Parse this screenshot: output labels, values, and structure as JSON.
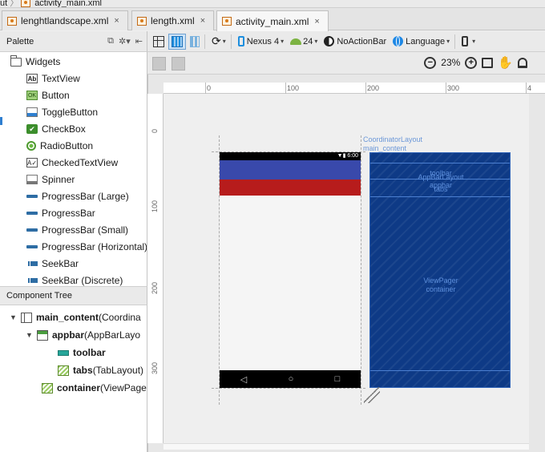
{
  "breadcrumb": {
    "first": "ut",
    "file": "activity_main.xml"
  },
  "tabs": [
    {
      "label": "lenghtlandscape.xml",
      "close": "×"
    },
    {
      "label": "length.xml",
      "close": "×"
    },
    {
      "label": "activity_main.xml",
      "close": "×",
      "active": true
    }
  ],
  "palette": {
    "title": "Palette",
    "group": "Widgets",
    "items": [
      {
        "label": "TextView",
        "icon": "textview-icon",
        "glyph": "Ab"
      },
      {
        "label": "Button",
        "icon": "button-icon",
        "glyph": "OK"
      },
      {
        "label": "ToggleButton",
        "icon": "toggle-button-icon",
        "glyph": ""
      },
      {
        "label": "CheckBox",
        "icon": "checkbox-icon",
        "glyph": "✔"
      },
      {
        "label": "RadioButton",
        "icon": "radio-button-icon",
        "glyph": ""
      },
      {
        "label": "CheckedTextView",
        "icon": "checked-textview-icon",
        "glyph": "A✓"
      },
      {
        "label": "Spinner",
        "icon": "spinner-icon",
        "glyph": ""
      },
      {
        "label": "ProgressBar (Large)",
        "icon": "progressbar-icon",
        "glyph": ""
      },
      {
        "label": "ProgressBar",
        "icon": "progressbar-icon",
        "glyph": ""
      },
      {
        "label": "ProgressBar (Small)",
        "icon": "progressbar-icon",
        "glyph": ""
      },
      {
        "label": "ProgressBar (Horizontal)",
        "icon": "progressbar-icon",
        "glyph": ""
      },
      {
        "label": "SeekBar",
        "icon": "seekbar-icon",
        "glyph": ""
      },
      {
        "label": "SeekBar (Discrete)",
        "icon": "seekbar-icon",
        "glyph": ""
      }
    ]
  },
  "toolbar": {
    "device": "Nexus 4",
    "api": "24",
    "theme": "NoActionBar",
    "language": "Language",
    "caret": "▾"
  },
  "zoom": {
    "minus": "−",
    "level": "23%",
    "plus": "+"
  },
  "component_tree": {
    "title": "Component Tree",
    "nodes": [
      {
        "id": "main_content",
        "type": " (Coordina"
      },
      {
        "id": "appbar",
        "type": " (AppBarLayo"
      },
      {
        "id": "toolbar",
        "type": ""
      },
      {
        "id": "tabs",
        "type": " (TabLayout)"
      },
      {
        "id": "container",
        "type": " (ViewPage"
      }
    ]
  },
  "ruler": {
    "top": [
      "0",
      "100",
      "200",
      "300",
      "4"
    ],
    "left": [
      "0",
      "100",
      "200",
      "300"
    ]
  },
  "preview": {
    "status_time": "6:00",
    "nav": [
      "◁",
      "○",
      "□"
    ]
  },
  "blueprint": {
    "root_label_1": "CoordinatorLayout",
    "root_label_2": "main_content",
    "toolbar_label": "toolbar",
    "appbar_label_1": "AppBarLayout",
    "appbar_label_2": "appbar",
    "tabs_label": "tabs",
    "pager_label_1": "ViewPager",
    "pager_label_2": "container"
  },
  "colors": {
    "appbar": "#3949ab",
    "tabs": "#b71c1c",
    "blueprint": "#0e3a86",
    "accent": "#1d8ede"
  }
}
